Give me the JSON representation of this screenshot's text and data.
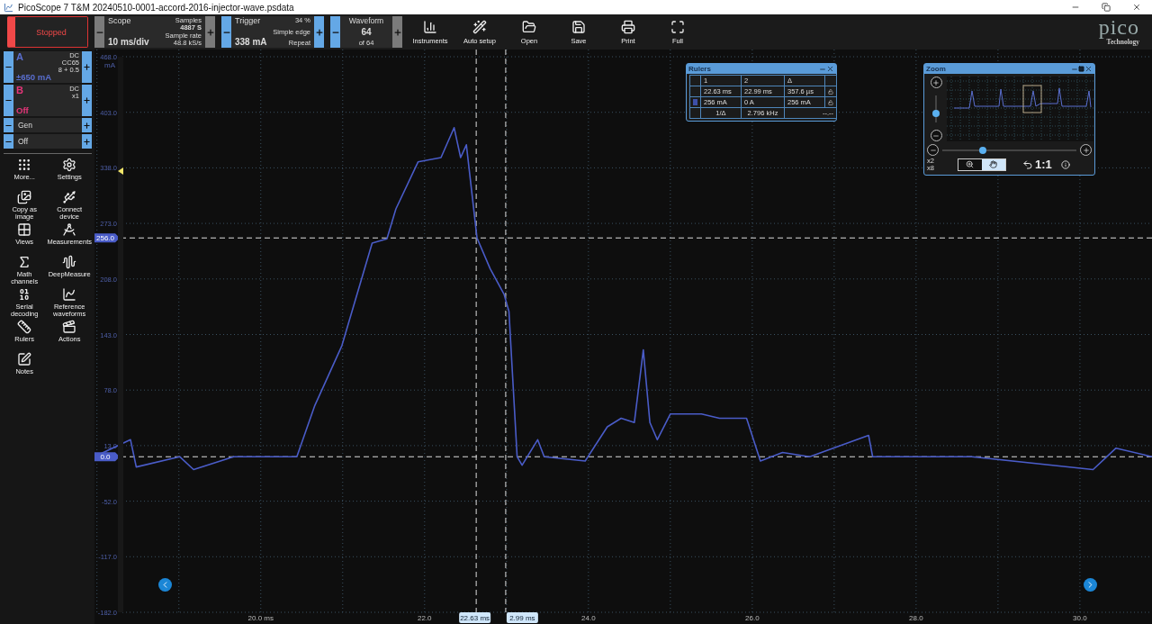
{
  "window": {
    "title": "PicoScope 7 T&M 20240510-0001-accord-2016-injector-wave.psdata"
  },
  "toolbar": {
    "run_button": {
      "label": "Stopped",
      "running": false
    },
    "scope": {
      "label": "Scope",
      "value": "10 ms/div",
      "samples_label": "Samples",
      "samples": "4887 S",
      "rate_label": "Sample rate",
      "rate": "48.8 kS/s"
    },
    "trigger": {
      "label": "Trigger",
      "value": "338 mA",
      "pretrigger": "34 %",
      "type": "Simple edge",
      "mode": "Repeat"
    },
    "waveform": {
      "label": "Waveform",
      "value": "64",
      "of": "of 64"
    },
    "tools": [
      {
        "kind": "instruments",
        "label": "Instruments"
      },
      {
        "kind": "autosetup",
        "label": "Auto setup"
      },
      {
        "kind": "open",
        "label": "Open"
      },
      {
        "kind": "save",
        "label": "Save"
      },
      {
        "kind": "print",
        "label": "Print"
      },
      {
        "kind": "full",
        "label": "Full"
      }
    ],
    "logo": {
      "name": "pico",
      "tagline": "Technology"
    }
  },
  "channels": [
    {
      "name": "A",
      "value": "±650 mA",
      "details": [
        "DC",
        "CC65",
        "8 + 0.5"
      ],
      "color": "#5a6fd0"
    },
    {
      "name": "B",
      "value": "Off",
      "details": [
        "DC",
        "x1"
      ],
      "color": "#e8357a"
    }
  ],
  "generator": {
    "name": "Gen",
    "state": "Off"
  },
  "sidebar_tools": [
    {
      "kind": "more",
      "label": "More..."
    },
    {
      "kind": "settings",
      "label": "Settings"
    },
    {
      "kind": "copy",
      "label": "Copy as image"
    },
    {
      "kind": "connect",
      "label": "Connect device"
    },
    {
      "kind": "views",
      "label": "Views"
    },
    {
      "kind": "measurements",
      "label": "Measurements"
    },
    {
      "kind": "math",
      "label": "Math channels"
    },
    {
      "kind": "deepmeasure",
      "label": "DeepMeasure"
    },
    {
      "kind": "serial",
      "label": "Serial decoding"
    },
    {
      "kind": "reference",
      "label": "Reference waveforms"
    },
    {
      "kind": "rulers",
      "label": "Rulers"
    },
    {
      "kind": "actions",
      "label": "Actions"
    },
    {
      "kind": "notes",
      "label": "Notes"
    }
  ],
  "scope_view": {
    "chart_data": {
      "type": "line",
      "ylabel": "mA",
      "grid": true,
      "xlim": [
        17.97,
        30.88
      ],
      "ylim": [
        -182,
        468
      ],
      "xticks": [
        {
          "value": 20,
          "label": "20.0 ms"
        },
        {
          "value": 22,
          "label": "22.0"
        },
        {
          "value": 24,
          "label": "24.0"
        },
        {
          "value": 26,
          "label": "26.0"
        },
        {
          "value": 28,
          "label": "28.0"
        },
        {
          "value": 30,
          "label": "30.0"
        }
      ],
      "yticks": [
        {
          "value": 468,
          "label": "468.0"
        },
        {
          "value": 403,
          "label": "403.0"
        },
        {
          "value": 338,
          "label": "338.0"
        },
        {
          "value": 273,
          "label": "273.0"
        },
        {
          "value": 208,
          "label": "208.0"
        },
        {
          "value": 143,
          "label": "143.0"
        },
        {
          "value": 78,
          "label": "78.0"
        },
        {
          "value": 13,
          "label": "13.0"
        },
        {
          "value": -52,
          "label": "-52.0"
        },
        {
          "value": -117,
          "label": "-117.0"
        },
        {
          "value": -182,
          "label": "-182.0"
        }
      ],
      "x": [
        17.97,
        18.41,
        18.48,
        19.01,
        19.18,
        19.67,
        20.44,
        20.66,
        20.99,
        21.36,
        21.54,
        21.65,
        21.92,
        22.2,
        22.36,
        22.44,
        22.51,
        22.64,
        22.8,
        22.97,
        23.03,
        23.13,
        23.19,
        23.38,
        23.46,
        23.96,
        24.23,
        24.4,
        24.56,
        24.67,
        24.75,
        24.84,
        25.0,
        25.38,
        25.6,
        25.93,
        26.1,
        26.37,
        26.7,
        27.42,
        27.47,
        28.68,
        30.16,
        30.44,
        30.88
      ],
      "series": [
        {
          "color": "#4a5cc8",
          "values": [
            0,
            20,
            -12,
            0,
            -15,
            0,
            0,
            60,
            130,
            250,
            255,
            290,
            345,
            350,
            385,
            350,
            365,
            256,
            220,
            190,
            170,
            0,
            -10,
            20,
            0,
            -5,
            35,
            45,
            40,
            125,
            40,
            20,
            50,
            50,
            45,
            45,
            -5,
            5,
            0,
            25,
            0,
            0,
            -15,
            10,
            0
          ]
        }
      ],
      "ref_lines": [
        {
          "axis": "y",
          "value": 256,
          "label": "256.0"
        },
        {
          "axis": "y",
          "value": 0,
          "label": "0.0"
        },
        {
          "axis": "x",
          "value": 22.63,
          "label": "22.63 ms"
        },
        {
          "axis": "x",
          "value": 22.99,
          "label": "2.99 ms"
        }
      ]
    },
    "trigger_marker": {
      "level": 0.8
    }
  },
  "rulers_window": {
    "title": "Rulers",
    "columns": [
      "1",
      "2",
      "Δ"
    ],
    "rows": [
      {
        "cells": [
          "22.63 ms",
          "22.99 ms",
          "357.6 µs"
        ]
      },
      {
        "color": "#3d4fa8",
        "cells": [
          "256 mA",
          "0 A",
          "256 mA"
        ]
      }
    ],
    "frequency": {
      "label": "1/Δ",
      "value": "2.796 kHz",
      "extra": "--.--"
    }
  },
  "zoom_window": {
    "title": "Zoom",
    "vertical_slider": {
      "level": 0.35
    },
    "horizontal_slider": {
      "level": 0.3
    },
    "factors": [
      "x2",
      "x8"
    ],
    "modes": [
      {
        "kind": "zoom",
        "selected": false
      },
      {
        "kind": "pan",
        "selected": true
      }
    ],
    "reset": "1:1"
  }
}
